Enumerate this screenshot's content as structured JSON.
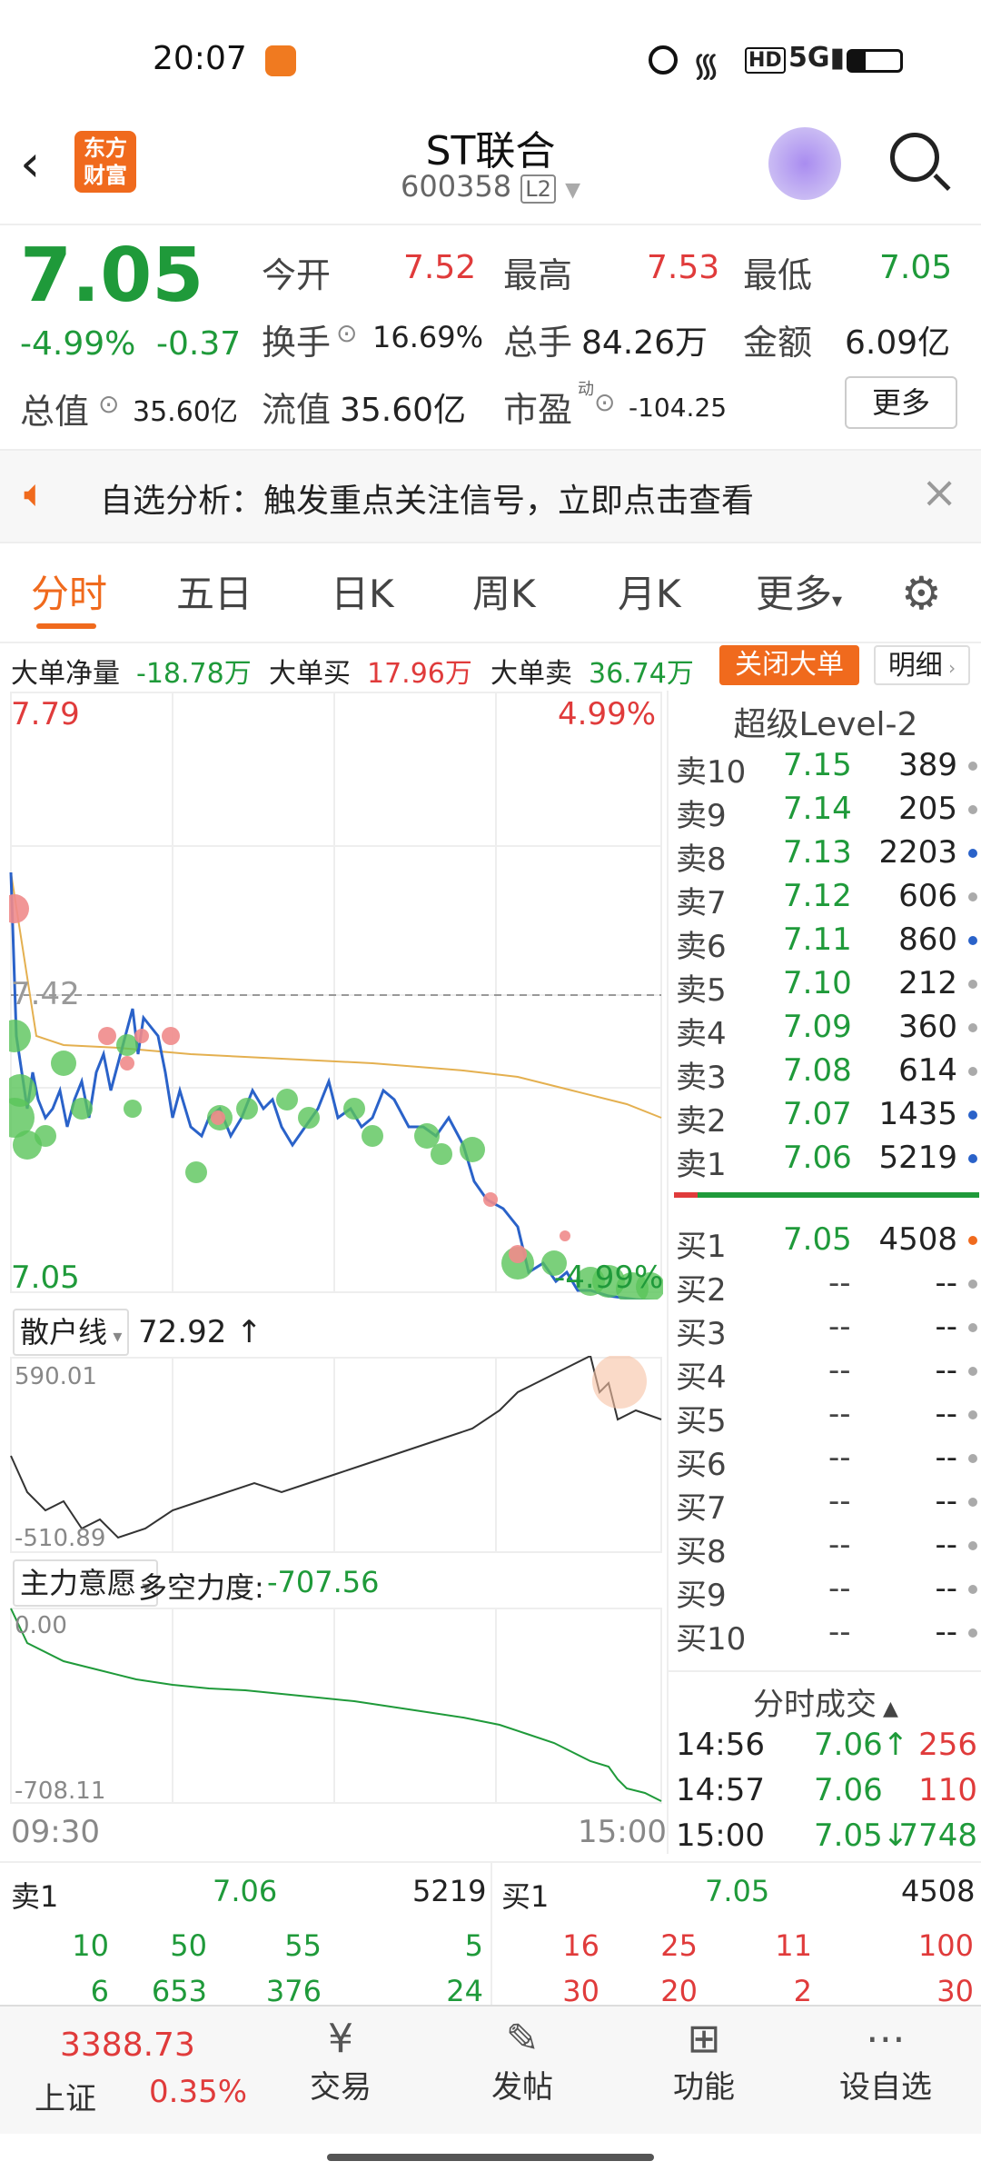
{
  "status": {
    "time": "20:07"
  },
  "header": {
    "logo": "东方\n财富",
    "title": "ST联合",
    "code": "600358",
    "level": "L2"
  },
  "quote": {
    "price": "7.05",
    "pct": "-4.99%",
    "chg": "-0.37",
    "open_label": "今开",
    "open": "7.52",
    "high_label": "最高",
    "high": "7.53",
    "low_label": "最低",
    "low": "7.05",
    "turnover_label": "换手",
    "turnover": "16.69%",
    "volume_label": "总手",
    "volume": "84.26万",
    "amount_label": "金额",
    "amount": "6.09亿",
    "mcap_label": "总值",
    "mcap": "35.60亿",
    "float_label": "流值",
    "float": "35.60亿",
    "pe_label": "市盈",
    "pe_sup": "动",
    "pe": "-104.25",
    "more": "更多"
  },
  "banner": {
    "text": "自选分析：触发重点关注信号，立即点击查看"
  },
  "tabs": [
    "分时",
    "五日",
    "日K",
    "周K",
    "月K",
    "更多"
  ],
  "bigorder": {
    "net_label": "大单净量",
    "net": "-18.78万",
    "buy_label": "大单买",
    "buy": "17.96万",
    "sell_label": "大单卖",
    "sell": "36.74万",
    "close_btn": "关闭大单",
    "detail_btn": "明细"
  },
  "chart": {
    "top_price": "7.79",
    "top_pct": "4.99%",
    "mid_price": "7.42",
    "bottom_price": "7.05",
    "bottom_pct": "-4.99%",
    "time_start": "09:30",
    "time_end": "15:00",
    "sub1_label": "散户线",
    "sub1_value": "72.92",
    "sub1_max": "590.01",
    "sub1_min": "-510.89",
    "sub2_label": "主力意愿",
    "sub2_title": "多空力度:",
    "sub2_value": "-707.56",
    "sub2_max": "0.00",
    "sub2_min": "-708.11"
  },
  "orderbook": {
    "title": "超级Level-2",
    "asks": [
      [
        "卖10",
        "7.15",
        "389"
      ],
      [
        "卖9",
        "7.14",
        "205"
      ],
      [
        "卖8",
        "7.13",
        "2203"
      ],
      [
        "卖7",
        "7.12",
        "606"
      ],
      [
        "卖6",
        "7.11",
        "860"
      ],
      [
        "卖5",
        "7.10",
        "212"
      ],
      [
        "卖4",
        "7.09",
        "360"
      ],
      [
        "卖3",
        "7.08",
        "614"
      ],
      [
        "卖2",
        "7.07",
        "1435"
      ],
      [
        "卖1",
        "7.06",
        "5219"
      ]
    ],
    "bids": [
      [
        "买1",
        "7.05",
        "4508"
      ],
      [
        "买2",
        "--",
        "--"
      ],
      [
        "买3",
        "--",
        "--"
      ],
      [
        "买4",
        "--",
        "--"
      ],
      [
        "买5",
        "--",
        "--"
      ],
      [
        "买6",
        "--",
        "--"
      ],
      [
        "买7",
        "--",
        "--"
      ],
      [
        "买8",
        "--",
        "--"
      ],
      [
        "买9",
        "--",
        "--"
      ],
      [
        "买10",
        "--",
        "--"
      ]
    ],
    "ticks_title": "分时成交",
    "ticks": [
      [
        "14:56",
        "7.06↑",
        "256"
      ],
      [
        "14:57",
        "7.06",
        "110"
      ],
      [
        "15:00",
        "7.05↓",
        "7748"
      ]
    ]
  },
  "queue": {
    "sell_label": "卖1",
    "sell_price": "7.06",
    "sell_vol": "5219",
    "buy_label": "买1",
    "buy_price": "7.05",
    "buy_vol": "4508",
    "sell_row1": [
      "10",
      "50",
      "55",
      "5"
    ],
    "sell_row2": [
      "6",
      "653",
      "376",
      "24"
    ],
    "buy_row1": [
      "16",
      "25",
      "11",
      "100"
    ],
    "buy_row2": [
      "30",
      "20",
      "2",
      "30"
    ]
  },
  "bottom": {
    "index_value": "3388.73",
    "index_name": "上证",
    "index_pct": "0.35%",
    "items": [
      "交易",
      "发帖",
      "功能",
      "设自选"
    ]
  }
}
